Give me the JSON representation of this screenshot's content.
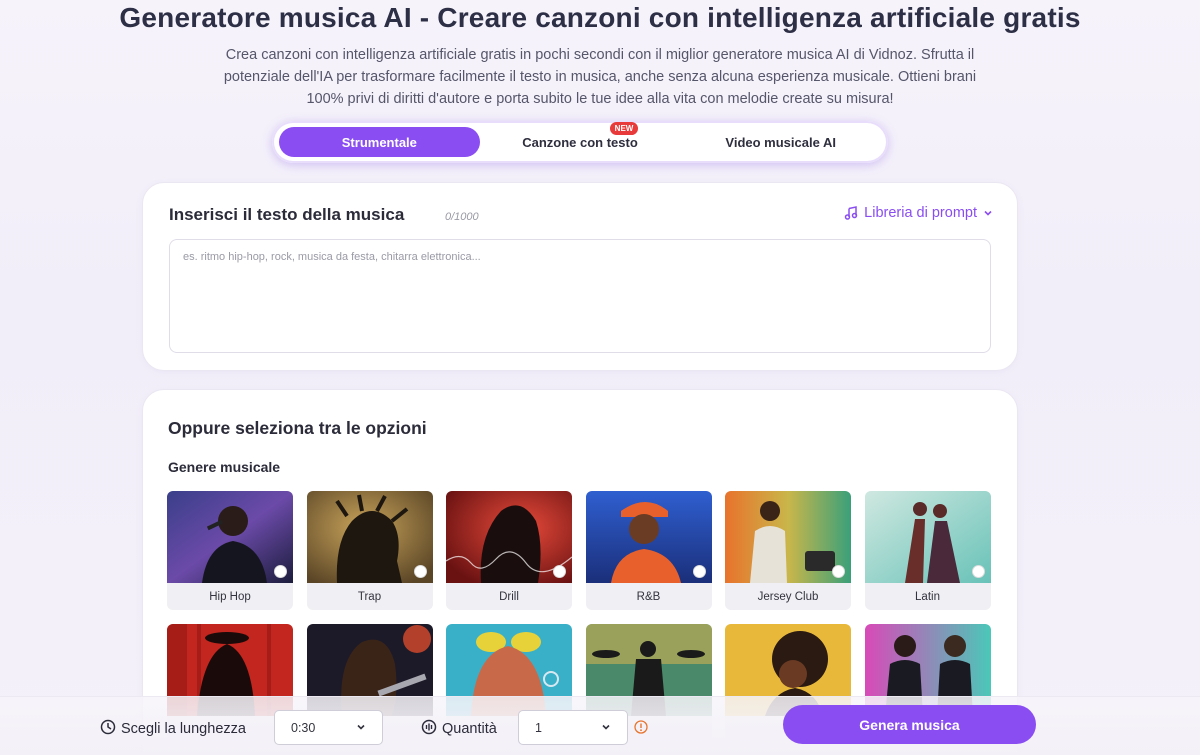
{
  "header": {
    "title": "Generatore musica AI - Creare canzoni con intelligenza artificiale gratis",
    "subtitle_lines": [
      "Crea canzoni con intelligenza artificiale gratis in pochi secondi con il miglior generatore musica AI di Vidnoz. Sfrutta il",
      "potenziale dell'IA per trasformare facilmente il testo in musica, anche senza alcuna esperienza musicale. Ottieni brani",
      "100% privi di diritti d'autore e porta subito le tue idee alla vita con melodie create su misura!"
    ]
  },
  "tabs": [
    {
      "label": "Strumentale",
      "active": true
    },
    {
      "label": "Canzone con testo",
      "badge": "NEW"
    },
    {
      "label": "Video musicale AI"
    }
  ],
  "lyrics": {
    "heading": "Inserisci il testo della musica",
    "counter": "0/1000",
    "prompt_library": "Libreria di prompt",
    "placeholder": "es. ritmo hip-hop, rock, musica da festa, chitarra elettronica...",
    "value": ""
  },
  "options": {
    "heading": "Oppure seleziona tra le opzioni",
    "genre_heading": "Genere musicale",
    "genres_row1": [
      "Hip Hop",
      "Trap",
      "Drill",
      "R&B",
      "Jersey Club",
      "Latin"
    ],
    "genres_row2_count_visible": 6
  },
  "bottom": {
    "length_label": "Scegli la lunghezza",
    "length_value": "0:30",
    "quantity_label": "Quantità",
    "quantity_value": "1",
    "generate_button": "Genera musica"
  },
  "colors": {
    "accent": "#8a4df2",
    "badge": "#e83a3a"
  }
}
